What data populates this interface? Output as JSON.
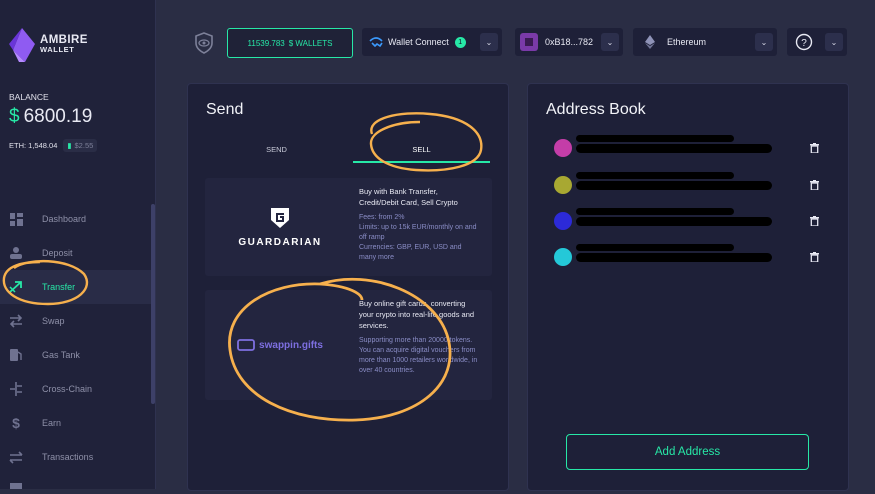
{
  "brand": {
    "line1": "AMBIRE",
    "line2": "WALLET"
  },
  "balance": {
    "label": "BALANCE",
    "currency": "$",
    "amount": "6800.19",
    "eth": "ETH: 1,548.04",
    "usd": "$2.55"
  },
  "nav": [
    {
      "label": "Dashboard",
      "icon": "dashboard-icon"
    },
    {
      "label": "Deposit",
      "icon": "deposit-icon"
    },
    {
      "label": "Transfer",
      "icon": "transfer-icon",
      "active": true
    },
    {
      "label": "Swap",
      "icon": "swap-icon"
    },
    {
      "label": "Gas Tank",
      "icon": "gas-tank-icon"
    },
    {
      "label": "Cross-Chain",
      "icon": "cross-chain-icon"
    },
    {
      "label": "Earn",
      "icon": "earn-icon"
    },
    {
      "label": "Transactions",
      "icon": "transactions-icon"
    }
  ],
  "topbar": {
    "wallets_amount": "11539.783",
    "wallets_label": "$ WALLETS",
    "wallet_connect": "Wallet Connect",
    "wc_count": "1",
    "account": "0xB18...782",
    "network": "Ethereum"
  },
  "send": {
    "title": "Send",
    "tab_send": "SEND",
    "tab_sell": "SELL",
    "guardarian": {
      "name": "GUARDARIAN",
      "desc": "Buy with Bank Transfer, Credit/Debit Card, Sell Crypto",
      "details": [
        "Fees: from 2%",
        "Limits: up to 15k EUR/monthly on and off ramp",
        "Currencies: GBP, EUR, USD and many more"
      ]
    },
    "swappin": {
      "name": "swappin.gifts",
      "desc": "Buy online gift cards, converting your crypto into real-life goods and services.",
      "details": "Supporting more than 20000 tokens. You can acquire digital vouchers from more than 1000 retailers worldwide, in over 40 countries."
    }
  },
  "address_book": {
    "title": "Address Book",
    "add_button": "Add Address"
  },
  "colors": {
    "accent": "#27e8a7",
    "annotation": "#f6b04d",
    "card": "#1e2038",
    "background": "#2a2d44"
  }
}
